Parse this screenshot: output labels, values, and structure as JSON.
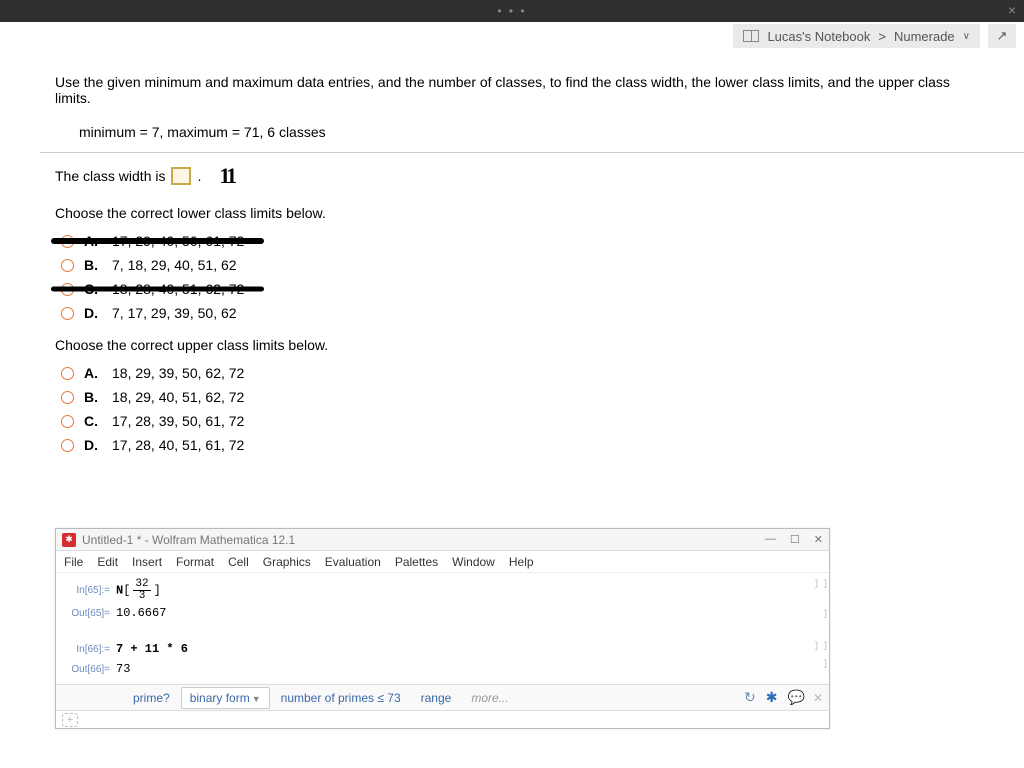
{
  "titlebar": {
    "dots": "• • •",
    "close": "×"
  },
  "breadcrumb": {
    "notebook": "Lucas's Notebook",
    "sep": ">",
    "site": "Numerade",
    "chev": "∨",
    "expand": "↗"
  },
  "problem": {
    "statement": "Use the given minimum and maximum data entries, and the number of classes, to find the class width, the lower class limits, and the upper class limits.",
    "given": "minimum = 7,   maximum = 71, 6 classes",
    "class_width_prefix": "The class width is",
    "class_width_suffix": ".",
    "handwritten": "11",
    "q_lower": "Choose the correct lower class limits below.",
    "lower_options": {
      "A": {
        "label": "A.",
        "values": "17, 29, 40, 50, 61, 72"
      },
      "B": {
        "label": "B.",
        "values": "7, 18, 29, 40, 51, 62"
      },
      "C": {
        "label": "C.",
        "values": "18, 28, 40, 51, 62, 72"
      },
      "D": {
        "label": "D.",
        "values": "7, 17, 29, 39, 50, 62"
      }
    },
    "q_upper": "Choose the correct upper class limits below.",
    "upper_options": {
      "A": {
        "label": "A.",
        "values": "18, 29, 39, 50, 62, 72"
      },
      "B": {
        "label": "B.",
        "values": "18, 29, 40, 51, 62, 72"
      },
      "C": {
        "label": "C.",
        "values": "17, 28, 39, 50, 61, 72"
      },
      "D": {
        "label": "D.",
        "values": "17, 28, 40, 51, 61, 72"
      }
    }
  },
  "mathematica": {
    "title": "Untitled-1 * - Wolfram Mathematica 12.1",
    "icon_glyph": "✱",
    "ctrls": {
      "min": "—",
      "max": "☐",
      "close": "✕"
    },
    "menu": [
      "File",
      "Edit",
      "Insert",
      "Format",
      "Cell",
      "Graphics",
      "Evaluation",
      "Palettes",
      "Window",
      "Help"
    ],
    "cells": {
      "in65_label": "In[65]:=",
      "in65_N": "N",
      "in65_num": "32",
      "in65_den": "3",
      "out65_label": "Out[65]=",
      "out65_val": "10.6667",
      "in66_label": "In[66]:=",
      "in66_val": "7 + 11 * 6",
      "out66_label": "Out[66]=",
      "out66_val": "73"
    },
    "suggest": {
      "prime": "prime?",
      "binary": "binary form",
      "nprimes": "number of primes ≤ 73",
      "range": "range",
      "more": "more...",
      "refresh": "↻",
      "gear": "✱",
      "chat": "💬",
      "close": "✕"
    },
    "add": "+"
  }
}
